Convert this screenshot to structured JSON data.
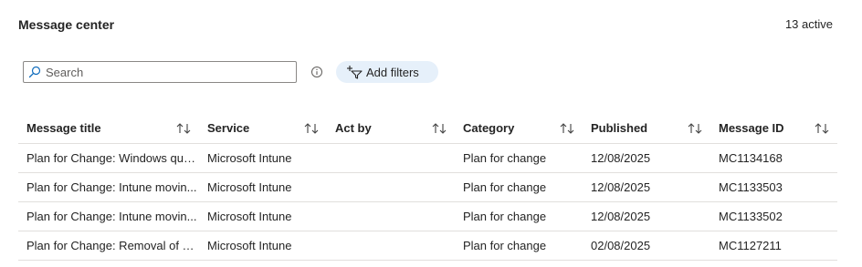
{
  "header": {
    "title": "Message center",
    "active_count": "13 active"
  },
  "search": {
    "placeholder": "Search",
    "value": ""
  },
  "toolbar": {
    "add_filters_label": "Add filters"
  },
  "table": {
    "columns": [
      "Message title",
      "Service",
      "Act by",
      "Category",
      "Published",
      "Message ID"
    ],
    "rows": [
      [
        "Plan for Change: Windows qua...",
        "Microsoft Intune",
        "",
        "Plan for change",
        "12/08/2025",
        "MC1134168"
      ],
      [
        "Plan for Change: Intune movin...",
        "Microsoft Intune",
        "",
        "Plan for change",
        "12/08/2025",
        "MC1133503"
      ],
      [
        "Plan for Change: Intune movin...",
        "Microsoft Intune",
        "",
        "Plan for change",
        "12/08/2025",
        "MC1133502"
      ],
      [
        "Plan for Change: Removal of M...",
        "Microsoft Intune",
        "",
        "Plan for change",
        "02/08/2025",
        "MC1127211"
      ]
    ]
  },
  "colors": {
    "accent": "#0f6cbd",
    "filter_bg": "#e6f0fa",
    "border": "#e1dfdd",
    "text": "#242424"
  },
  "icons": {
    "search": "search-icon",
    "info": "info-icon",
    "filter": "add-filter-icon",
    "sort": "sort-arrows-icon"
  }
}
